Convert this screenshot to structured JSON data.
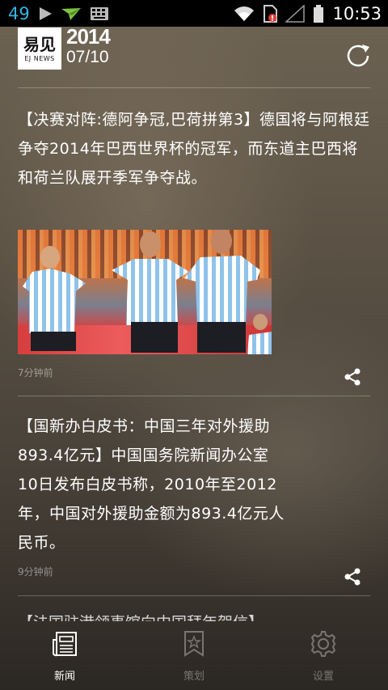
{
  "status_bar": {
    "notification_count": "49",
    "time": "10:53",
    "icons": [
      "play-icon",
      "paper-plane-icon",
      "keyboard-icon",
      "wifi-icon",
      "sim-alert-icon",
      "signal-icon",
      "battery-icon"
    ]
  },
  "header": {
    "logo_cn": "易见",
    "logo_en": "EJ NEWS",
    "year": "2014",
    "month_day": "07/10",
    "refresh_icon": "refresh-icon"
  },
  "feed": [
    {
      "headline": "【决赛对阵:德阿争冠,巴荷拼第3】德国将与阿根廷争夺2014年巴西世界杯的冠军，而东道主巴西将和荷兰队展开季军争夺战。",
      "has_photo": true,
      "time_ago": "7分钟前",
      "share_icon": "share-icon"
    },
    {
      "headline": "【国新办白皮书：中国三年对外援助893.4亿元】中国国务院新闻办公室10日发布白皮书称，2010年至2012年，中国对外援助金额为893.4亿元人民币。",
      "has_photo": false,
      "time_ago": "9分钟前",
      "share_icon": "share-icon"
    }
  ],
  "peek_text": "【法国驻港领事馆向中国拜年贺信】",
  "bottom_nav": [
    {
      "label": "新闻",
      "icon": "newspaper-icon",
      "active": true
    },
    {
      "label": "策划",
      "icon": "bookmark-star-icon",
      "active": false
    },
    {
      "label": "设置",
      "icon": "gear-icon",
      "active": false
    }
  ],
  "colors": {
    "status_accent": "#33b5e5",
    "text_primary": "#ffffff",
    "text_muted": "rgba(255,255,255,0.45)"
  }
}
